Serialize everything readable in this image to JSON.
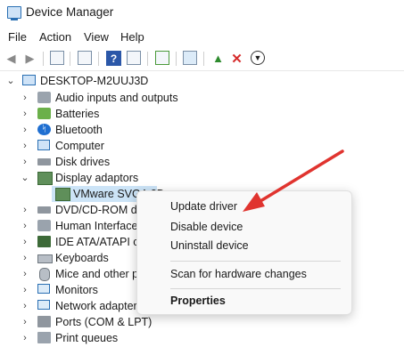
{
  "window": {
    "title": "Device Manager",
    "app_icon": "device-manager-icon"
  },
  "menu": {
    "file": "File",
    "action": "Action",
    "view": "View",
    "help": "Help"
  },
  "toolbar": {
    "icons": [
      "back-arrow-icon",
      "forward-arrow-icon",
      "properties-icon",
      "update-icon",
      "help-icon",
      "show-hidden-icon",
      "scan-icon",
      "monitor-icon",
      "add-driver-icon",
      "uninstall-x-icon",
      "download-icon"
    ]
  },
  "tree": {
    "root": "DESKTOP-M2UUJ3D",
    "items": [
      {
        "label": "Audio inputs and outputs",
        "icon": "speaker-icon"
      },
      {
        "label": "Batteries",
        "icon": "battery-icon"
      },
      {
        "label": "Bluetooth",
        "icon": "bluetooth-icon"
      },
      {
        "label": "Computer",
        "icon": "computer-icon"
      },
      {
        "label": "Disk drives",
        "icon": "disk-drive-icon"
      },
      {
        "label": "Display adaptors",
        "icon": "display-adapter-icon",
        "expanded": true
      },
      {
        "label": "VMware SVGA 3D",
        "icon": "display-adapter-icon",
        "child": true,
        "selected": true
      },
      {
        "label": "DVD/CD-ROM dr",
        "icon": "dvd-icon"
      },
      {
        "label": "Human Interface",
        "icon": "hid-icon"
      },
      {
        "label": "IDE ATA/ATAPI cc",
        "icon": "ide-icon"
      },
      {
        "label": "Keyboards",
        "icon": "keyboard-icon"
      },
      {
        "label": "Mice and other p",
        "icon": "mouse-icon"
      },
      {
        "label": "Monitors",
        "icon": "monitor-icon"
      },
      {
        "label": "Network adapter",
        "icon": "network-icon"
      },
      {
        "label": "Ports (COM & LPT)",
        "icon": "port-icon"
      },
      {
        "label": "Print queues",
        "icon": "printer-icon"
      }
    ]
  },
  "context_menu": {
    "update_driver": "Update driver",
    "disable_device": "Disable device",
    "uninstall_device": "Uninstall device",
    "scan": "Scan for hardware changes",
    "properties": "Properties"
  },
  "colors": {
    "accent": "#2a6fb3",
    "selection": "#cce4f7",
    "arrow": "#e0342f"
  }
}
